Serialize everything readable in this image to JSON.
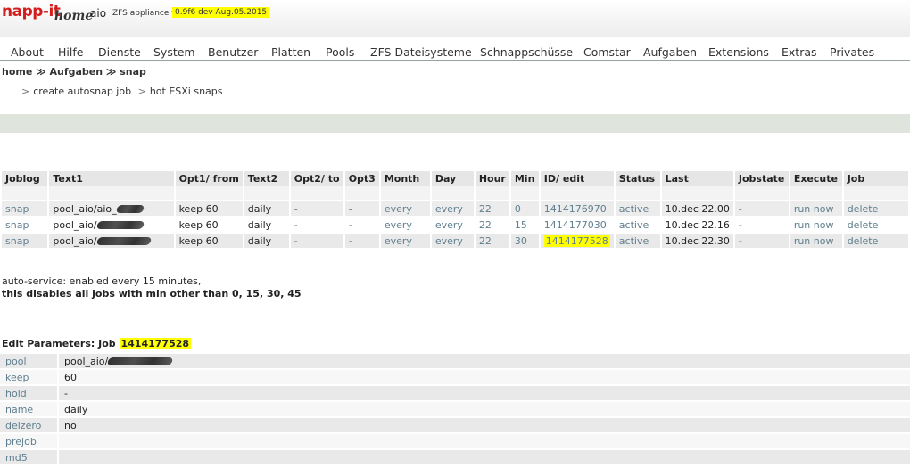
{
  "header": {
    "logo": "napp-it",
    "logo_sub": "home",
    "host": "aio",
    "appliance": "ZFS appliance v.",
    "version": "0.9f6 dev Aug.05.2015"
  },
  "menu": [
    "About",
    "Hilfe",
    "Dienste",
    "System",
    "Benutzer",
    "Platten",
    "Pools",
    "ZFS Dateisysteme",
    "Schnappschüsse",
    "Comstar",
    "Aufgaben",
    "Extensions",
    "Extras",
    "Privates"
  ],
  "breadcrumb": "home ≫ Aufgaben ≫ snap",
  "subnav": {
    "sep": ">",
    "item1": "create autosnap job",
    "item2": "hot ESXi snaps"
  },
  "jobs": {
    "columns": [
      "Joblog",
      "Text1",
      "Opt1/ from",
      "Text2",
      "Opt2/ to",
      "Opt3",
      "Month",
      "Day",
      "Hour",
      "Min",
      "ID/ edit",
      "Status",
      "Last",
      "Jobstate",
      "Execute",
      "Job"
    ],
    "rows": [
      {
        "joblog": "snap",
        "text1": "pool_aio/aio_",
        "opt1": "keep 60",
        "text2": "daily",
        "opt2": "-",
        "opt3": "-",
        "month": "every",
        "day": "every",
        "hour": "22",
        "min": "0",
        "id": "1414176970",
        "status": "active",
        "last": "10.dec 22.00",
        "jobstate": "-",
        "execute": "run now",
        "job": "delete"
      },
      {
        "joblog": "snap",
        "text1": "pool_aio/",
        "opt1": "keep 60",
        "text2": "daily",
        "opt2": "-",
        "opt3": "-",
        "month": "every",
        "day": "every",
        "hour": "22",
        "min": "15",
        "id": "1414177030",
        "status": "active",
        "last": "10.dec 22.16",
        "jobstate": "-",
        "execute": "run now",
        "job": "delete"
      },
      {
        "joblog": "snap",
        "text1": "pool_aio/",
        "opt1": "keep 60",
        "text2": "daily",
        "opt2": "-",
        "opt3": "-",
        "month": "every",
        "day": "every",
        "hour": "22",
        "min": "30",
        "id": "1414177528",
        "status": "active",
        "last": "10.dec 22.30",
        "jobstate": "-",
        "execute": "run now",
        "job": "delete"
      }
    ]
  },
  "autoservice": {
    "line1": "auto-service: enabled every 15 minutes,",
    "line2": "this disables all jobs with min other than 0, 15, 30, 45"
  },
  "edit": {
    "heading": "Edit Parameters: Job",
    "job_id": "1414177528",
    "params": [
      {
        "name": "pool",
        "value": "pool_aio/"
      },
      {
        "name": "keep",
        "value": "60"
      },
      {
        "name": "hold",
        "value": "-"
      },
      {
        "name": "name",
        "value": "daily"
      },
      {
        "name": "delzero",
        "value": "no"
      },
      {
        "name": "prejob",
        "value": ""
      },
      {
        "name": "md5",
        "value": ""
      }
    ]
  },
  "colors": {
    "highlight": "#ffff00",
    "link": "#5f7f8f",
    "logo": "#d41d1d",
    "bar": "#dfe5dc"
  }
}
